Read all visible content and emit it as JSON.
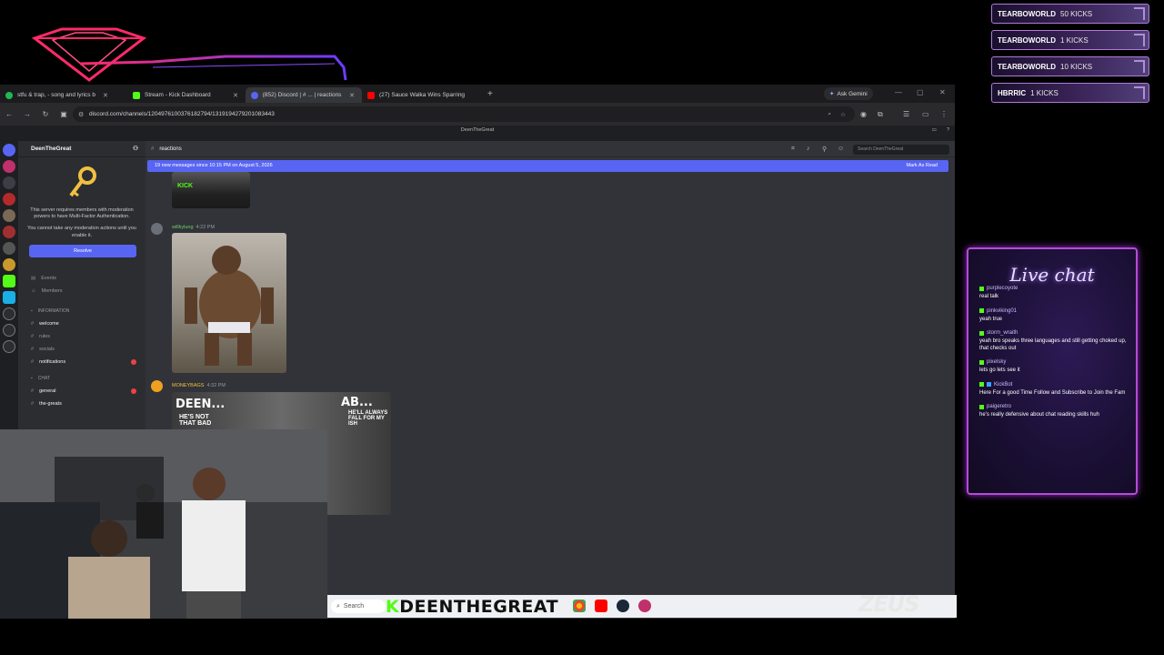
{
  "kick_alerts": [
    {
      "user": "TEARBOWORLD",
      "count": "50 KICKS"
    },
    {
      "user": "TEARBOWORLD",
      "count": "1 KICKS"
    },
    {
      "user": "TEARBOWORLD",
      "count": "10 KICKS"
    },
    {
      "user": "HBRRIC",
      "count": "1 KICKS"
    }
  ],
  "browser": {
    "tabs": [
      {
        "label": "stfu & trap, - song and lyrics b",
        "color": "#1db954",
        "active": false
      },
      {
        "label": "Stream - Kick Dashboard",
        "color": "#53fc18",
        "active": false
      },
      {
        "label": "(852) Discord | # ... | reactions",
        "color": "#5865f2",
        "active": true
      },
      {
        "label": "(27) Sauce Walka Wins Sparring",
        "color": "#ff0000",
        "active": false
      }
    ],
    "new_tab": "+",
    "gemini_label": "Ask Gemini",
    "url": "discord.com/channels/1204976100376182794/1319194279201083443"
  },
  "discord": {
    "window_title": "DeenTheGreat",
    "server_name": "DeenTheGreat",
    "mfa_text": "This server requires members with moderation powers to have Multi-Factor Authentication.",
    "mfa_text2": "You cannot take any moderation actions until you enable it.",
    "resolve_label": "Resolve",
    "nav": [
      {
        "label": "Events"
      },
      {
        "label": "Members"
      }
    ],
    "categories": {
      "information": "INFORMATION",
      "chat": "CHAT"
    },
    "info_channels": [
      {
        "label": "welcome",
        "highlight": true,
        "mention": false
      },
      {
        "label": "rules",
        "highlight": false,
        "mention": false
      },
      {
        "label": "socials",
        "highlight": false,
        "mention": false
      },
      {
        "label": "notifications",
        "highlight": true,
        "mention": true
      }
    ],
    "chat_channels": [
      {
        "label": "general",
        "highlight": true,
        "mention": true
      },
      {
        "label": "the-greats",
        "highlight": true,
        "mention": false
      }
    ],
    "channel_name": "reactions",
    "search_placeholder": "Search DeenTheGreat",
    "new_messages_banner": "19 new messages since 10:15 PM on August 5, 2026",
    "mark_as_read": "Mark As Read",
    "messages": [
      {
        "author": "willkylung",
        "time": "4:22 PM"
      },
      {
        "author": "MONEYBAGS",
        "time": "4:32 PM"
      }
    ],
    "thumb_captions": {
      "left_top": "DEEN...",
      "left_bottom": "HE'S NOT THAT BAD",
      "right_top": "AB...",
      "right_bottom": "HE'LL ALWAYS FALL FOR MY ISH"
    }
  },
  "taskbar": {
    "search": "Search",
    "channel_name": "DEENTHEGREAT",
    "kick_letter": "K",
    "brand": "ZEUS"
  },
  "livechat": {
    "title": "Live chat",
    "messages": [
      {
        "user": "purplecoyote",
        "text": "real talk"
      },
      {
        "user": "pinkviking01",
        "text": "yeah true"
      },
      {
        "user": "storm_wraith",
        "text": "yeah bro speaks three languages and still getting choked up, that checks out"
      },
      {
        "user": "pixelsky",
        "text": "lets go lets see it"
      },
      {
        "user": "KickBot",
        "text": "Here For a good Time Follow and Subscribe to Join the Fam"
      },
      {
        "user": "paigeretro",
        "text": "he's really defensive about chat reading skills huh"
      }
    ]
  },
  "colors": {
    "accent_purple": "#b44bd6",
    "discord_blurple": "#5865f2",
    "kick_green": "#53fc18"
  }
}
